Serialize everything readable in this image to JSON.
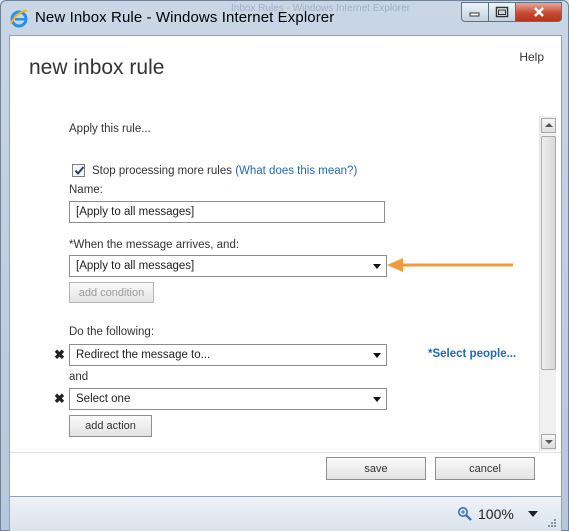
{
  "window": {
    "title": "New Inbox Rule - Windows Internet Explorer",
    "background_tabs": "Inbox Rules - Windows Internet Explorer"
  },
  "header": {
    "help_label": "Help",
    "page_title": "new inbox rule"
  },
  "form": {
    "apply_text": "Apply this rule...",
    "stop_processing": {
      "checked": true,
      "label": "Stop processing more rules",
      "link": "(What does this mean?)"
    },
    "name_label": "Name:",
    "name_value": "[Apply to all messages]",
    "condition_label": "*When the message arrives, and:",
    "condition_value": "[Apply to all messages]",
    "add_condition_label": "add condition",
    "actions_label": "Do the following:",
    "action1_value": "Redirect the message to...",
    "select_people_link": "*Select people...",
    "and_label": "and",
    "action2_value": "Select one",
    "add_action_label": "add action",
    "remove_icon": "✖"
  },
  "footer": {
    "save_label": "save",
    "cancel_label": "cancel"
  },
  "statusbar": {
    "zoom_level": "100%"
  },
  "colors": {
    "link": "#1f6ab3",
    "annotation_arrow": "#f39a3c"
  }
}
